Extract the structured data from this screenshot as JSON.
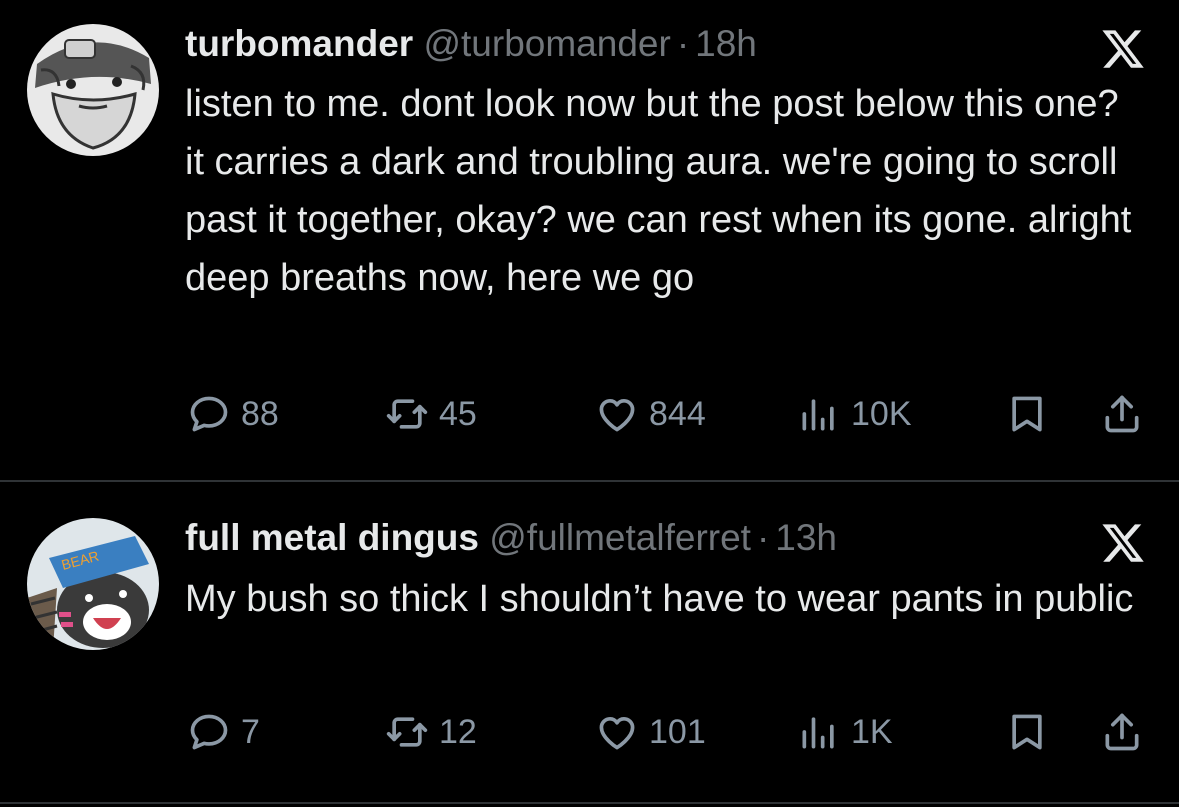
{
  "tweets": [
    {
      "display_name": "turbomander",
      "handle": "@turbomander",
      "separator": "·",
      "time": "18h",
      "text": "listen to me. dont look now but the post below this one? it carries a dark and troubling aura. we're going to scroll past it together, okay? we can rest when its gone. alright deep breaths now, here we go",
      "stats": {
        "replies": "88",
        "reposts": "45",
        "likes": "844",
        "views": "10K"
      }
    },
    {
      "display_name": "full metal dingus",
      "handle": "@fullmetalferret",
      "separator": "·",
      "time": "13h",
      "text": "My bush so thick I shouldn’t have to wear pants in public",
      "stats": {
        "replies": "7",
        "reposts": "12",
        "likes": "101",
        "views": "1K"
      },
      "avatar_hat_text": "BEAR"
    }
  ],
  "colors": {
    "background": "#000000",
    "text_primary": "#e7e9ea",
    "text_secondary": "#71767b",
    "divider": "#2f3336"
  },
  "icons": [
    "reply-icon",
    "repost-icon",
    "like-icon",
    "views-icon",
    "bookmark-icon",
    "share-icon",
    "x-logo-icon"
  ]
}
